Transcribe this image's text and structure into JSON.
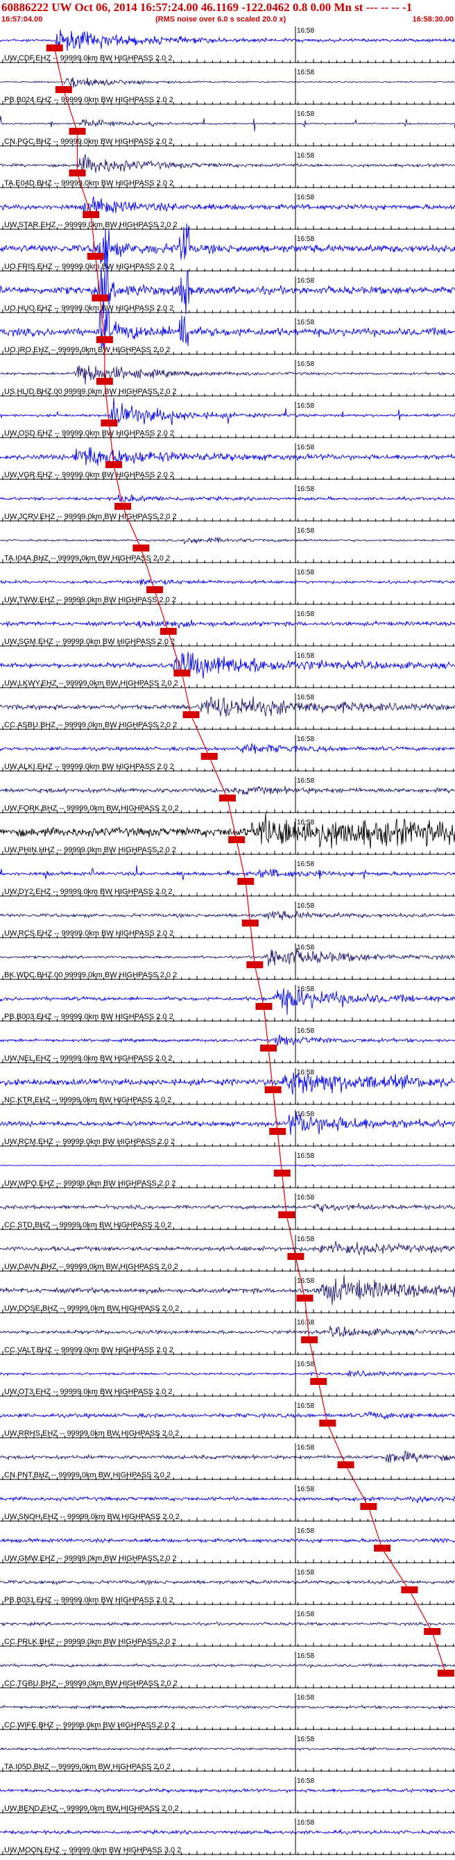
{
  "header": {
    "title": "60886222 UW Oct 06, 2014 16:57:24.00    46.1169 -122.0462  0.8 0.00 Mn st --- -- --  -1",
    "start_time": "16:57:04.00",
    "end_time": "16:58:30.00",
    "rms_note": "(RMS noise over 6.0 s scaled 20.0 x)"
  },
  "minute_marker": "16:58",
  "colors": {
    "blue": "#0000ee",
    "navy": "#1a1a70",
    "black": "#000000",
    "pick": "#d40000",
    "pick_line": "#e00000"
  },
  "traces": [
    {
      "label": "UW.CDF.EHZ -- 99999.0km BW  HIGHPASS  2.0  2",
      "color": "blue",
      "pick": "",
      "onset": 0.12,
      "amp": 0.85,
      "decay": 0.15,
      "noise": 0.12
    },
    {
      "label": "PB.B024.EHZ -- 99999.0km BW  HIGHPASS  2.0  2",
      "color": "navy",
      "pick": "",
      "onset": 0.14,
      "amp": 0.6,
      "decay": 0.1,
      "noise": 0.05
    },
    {
      "label": "CN.PGC.BHZ -- 99999.0km BW  HIGHPASS  2.0  2",
      "color": "navy",
      "pick": "",
      "onset": 0.17,
      "amp": 0.35,
      "decay": 0.1,
      "noise": 0.06,
      "spikes": 9
    },
    {
      "label": "TA.E04D.BHZ -- 99999.0km BW  HIGHPASS  2.0  2",
      "color": "navy",
      "pick": "",
      "onset": 0.17,
      "amp": 0.8,
      "decay": 0.12,
      "noise": 0.12
    },
    {
      "label": "UW.STAR.EHZ -- 99999.0km BW  HIGHPASS  2.0  2",
      "color": "blue",
      "pick": "",
      "onset": 0.18,
      "amp": 0.7,
      "decay": 0.1,
      "noise": 0.2
    },
    {
      "label": "UO.FRIS.EHZ -- 99999.0km BW  HIGHPASS  2.0  2",
      "color": "blue",
      "pick": "",
      "onset": 0.2,
      "amp": 0.5,
      "decay": 0.1,
      "noise": 0.3,
      "bursts": [
        0.23,
        0.405
      ]
    },
    {
      "label": "UO.HUO.EHZ -- 99999.0km BW  HIGHPASS  2.0  2",
      "color": "blue",
      "pick": "",
      "onset": 0.21,
      "amp": 0.5,
      "decay": 0.1,
      "noise": 0.3,
      "bursts": [
        0.23,
        0.405
      ]
    },
    {
      "label": "UO.IRO.EHZ -- 99999.0km BW  HIGHPASS  2.0  2",
      "color": "blue",
      "pick": "",
      "onset": 0.22,
      "amp": 0.6,
      "decay": 0.1,
      "noise": 0.3,
      "bursts": [
        0.23,
        0.405
      ]
    },
    {
      "label": "US.HLID.BHZ.00 99999.0km BW  HIGHPASS  2.0  2",
      "color": "navy",
      "pick": "",
      "onset": 0.16,
      "amp": 1.0,
      "decay": 0.12,
      "noise": 0.1
    },
    {
      "label": "UW.OSD.EHZ -- 99999.0km BW  HIGHPASS  2.0  2",
      "color": "blue",
      "pick": "",
      "onset": 0.24,
      "amp": 1.0,
      "decay": 0.12,
      "noise": 0.1,
      "spikes": 8
    },
    {
      "label": "UW.VGR.EHZ -- 99999.0km BW  HIGHPASS  2.0  2",
      "color": "blue",
      "pick": "",
      "onset": 0.16,
      "amp": 0.9,
      "decay": 0.15,
      "noise": 0.2
    },
    {
      "label": "UW.JCRV.EHZ -- 99999.0km BW  HIGHPASS  2.0  2",
      "color": "blue",
      "pick": "",
      "onset": 0.25,
      "amp": 0.25,
      "decay": 0.1,
      "noise": 0.12
    },
    {
      "label": "TA.I04A.BHZ -- 99999.0km BW  HIGHPASS  2.0  2",
      "color": "navy",
      "pick": "",
      "onset": 0.4,
      "amp": 0.3,
      "decay": 0.1,
      "noise": 0.08
    },
    {
      "label": "UW.TWW.EHZ -- 99999.0km BW  HIGHPASS  2.0  2",
      "color": "blue",
      "pick": "",
      "onset": 0.3,
      "amp": 0.2,
      "decay": 0.1,
      "noise": 0.12
    },
    {
      "label": "UW.SGM.EHZ -- 99999.0km BW  HIGHPASS  2.0  2",
      "color": "blue",
      "pick": "",
      "onset": 0.3,
      "amp": 0.3,
      "decay": 0.1,
      "noise": 0.16
    },
    {
      "label": "UW.LKWY.EHZ -- 99999.0km BW  HIGHPASS  2.0  2",
      "color": "blue",
      "pick": "",
      "onset": 0.38,
      "amp": 1.0,
      "decay": 0.2,
      "noise": 0.2
    },
    {
      "label": "CC.ASBU.BHZ -- 99999.0km BW  HIGHPASS  2.0  2",
      "color": "navy",
      "pick": "",
      "onset": 0.44,
      "amp": 1.0,
      "decay": 0.2,
      "noise": 0.2
    },
    {
      "label": "UW.ALKI.EHZ -- 99999.0km BW  HIGHPASS  2.0  2",
      "color": "blue",
      "pick": "",
      "onset": 0.52,
      "amp": 0.4,
      "decay": 0.1,
      "noise": 0.15
    },
    {
      "label": "UW.FORK.BHZ -- 99999.0km BW  HIGHPASS  2.0  2",
      "color": "navy",
      "pick": "",
      "onset": 0.52,
      "amp": 0.25,
      "decay": 0.1,
      "noise": 0.18
    },
    {
      "label": "UW.PHIN.HHZ -- 99999.0km BW  HIGHPASS  2.0  2",
      "color": "black",
      "pick": "",
      "onset": 0.55,
      "amp": 1.0,
      "decay": 0.9,
      "noise": 0.35
    },
    {
      "label": "UW.DY2.EHZ -- 99999.0km BW  HIGHPASS  2.0  2",
      "color": "blue",
      "pick": "",
      "onset": 0.56,
      "amp": 0.3,
      "decay": 0.1,
      "noise": 0.14,
      "spikes": 10
    },
    {
      "label": "UW.RCS.EHZ -- 99999.0km BW  HIGHPASS  2.0  2",
      "color": "navy",
      "pick": "",
      "onset": 0.58,
      "amp": 0.35,
      "decay": 0.1,
      "noise": 0.14
    },
    {
      "label": "BK.WDC.BHZ.00 99999.0km BW  HIGHPASS  2.0  2",
      "color": "navy",
      "pick": "",
      "onset": 0.58,
      "amp": 0.9,
      "decay": 0.15,
      "noise": 0.1
    },
    {
      "label": "PB.B003.EHZ -- 99999.0km BW  HIGHPASS  2.0  2",
      "color": "blue",
      "pick": "",
      "onset": 0.6,
      "amp": 1.0,
      "decay": 0.15,
      "noise": 0.15
    },
    {
      "label": "UW.NEL.EHZ -- 99999.0km BW  HIGHPASS  2.0  2",
      "color": "blue",
      "pick": "",
      "onset": 0.6,
      "amp": 0.4,
      "decay": 0.1,
      "noise": 0.12
    },
    {
      "label": "NC.KTR.EHZ -- 99999.0km BW  HIGHPASS  2.0  2",
      "color": "blue",
      "pick": "",
      "onset": 0.62,
      "amp": 1.0,
      "decay": 0.2,
      "noise": 0.25
    },
    {
      "label": "UW.RCM.EHZ -- 99999.0km BW  HIGHPASS  2.0  2",
      "color": "blue",
      "pick": "",
      "onset": 0.63,
      "amp": 0.9,
      "decay": 0.15,
      "noise": 0.2
    },
    {
      "label": "UW.WPO.EHZ -- 99999.0km BW  HIGHPASS  2.0  2",
      "color": "blue",
      "pick": "",
      "onset": 0.66,
      "amp": 0.1,
      "decay": 0.1,
      "noise": 0.03
    },
    {
      "label": "CC.STD.BHZ -- 99999.0km BW  HIGHPASS  2.0  2",
      "color": "navy",
      "pick": "",
      "onset": 0.68,
      "amp": 0.3,
      "decay": 0.1,
      "noise": 0.15
    },
    {
      "label": "UW.DAVN.BHZ -- 99999.0km BW  HIGHPASS  2.0  2",
      "color": "navy",
      "pick": "",
      "onset": 0.7,
      "amp": 0.55,
      "decay": 0.15,
      "noise": 0.18
    },
    {
      "label": "UW.DOSE.BHZ -- 99999.0km BW  HIGHPASS  2.0  2",
      "color": "navy",
      "pick": "",
      "onset": 0.7,
      "amp": 1.0,
      "decay": 0.2,
      "noise": 0.2
    },
    {
      "label": "CC.VALT.BHZ -- 99999.0km BW  HIGHPASS  2.0  2",
      "color": "navy",
      "pick": "",
      "onset": 0.72,
      "amp": 0.4,
      "decay": 0.1,
      "noise": 0.15
    },
    {
      "label": "UW.OT3.EHZ -- 99999.0km BW  HIGHPASS  2.0  2",
      "color": "blue",
      "pick": "",
      "onset": 0.76,
      "amp": 0.2,
      "decay": 0.1,
      "noise": 0.1
    },
    {
      "label": "UW.RRHS.EHZ -- 99999.0km BW  HIGHPASS  2.0  2",
      "color": "blue",
      "pick": "",
      "onset": 0.8,
      "amp": 0.2,
      "decay": 0.1,
      "noise": 0.16
    },
    {
      "label": "CN.PNT.BHZ -- 99999.0km BW  HIGHPASS  2.0  2",
      "color": "navy",
      "pick": "",
      "onset": 0.84,
      "amp": 0.5,
      "decay": 0.1,
      "noise": 0.15
    },
    {
      "label": "UW.SNOH.EHZ -- 99999.0km BW  HIGHPASS  2.0  2",
      "color": "blue",
      "pick": "",
      "onset": 0.9,
      "amp": 0.2,
      "decay": 0.1,
      "noise": 0.15
    },
    {
      "label": "UW.GMW.EHZ -- 99999.0km BW  HIGHPASS  2.0  2",
      "color": "blue",
      "pick": "",
      "onset": 0.95,
      "amp": 0.1,
      "decay": 0.1,
      "noise": 0.15
    },
    {
      "label": "PB.B031.EHZ -- 99999.0km BW  HIGHPASS  2.0  2",
      "color": "navy",
      "pick": "",
      "onset": 1.1,
      "amp": 0.0,
      "decay": 0.1,
      "noise": 0.15
    },
    {
      "label": "CC.PRLK.BHZ -- 99999.0km BW  HIGHPASS  2.0  2",
      "color": "navy",
      "pick": "",
      "onset": 1.1,
      "amp": 0.0,
      "decay": 0.1,
      "noise": 0.12
    },
    {
      "label": "CC.TGBU.BHZ -- 99999.0km BW  HIGHPASS  2.0  2",
      "color": "navy",
      "pick": "",
      "onset": 1.1,
      "amp": 0.0,
      "decay": 0.1,
      "noise": 0.12
    },
    {
      "label": "CC.WIFE.BHZ -- 99999.0km BW  HIGHPASS  2.0  2",
      "color": "navy",
      "pick": "",
      "onset": 1.1,
      "amp": 0.0,
      "decay": 0.1,
      "noise": 0.12
    },
    {
      "label": "TA.I05D.BHZ -- 99999.0km BW  HIGHPASS  2.0  2",
      "color": "navy",
      "pick": "",
      "onset": 1.1,
      "amp": 0.0,
      "decay": 0.1,
      "noise": 0.1
    },
    {
      "label": "UW.BEND.EHZ -- 99999.0km BW  HIGHPASS  2.0  2",
      "color": "blue",
      "pick": "",
      "onset": 1.1,
      "amp": 0.0,
      "decay": 0.1,
      "noise": 0.14
    },
    {
      "label": "UW.MOON.EHZ -- 99999.0km BW  HIGHPASS  3.0  2",
      "color": "blue",
      "pick": "",
      "onset": 1.1,
      "amp": 0.0,
      "decay": 0.1,
      "noise": 0.14
    }
  ],
  "picks": [
    0.12,
    0.14,
    0.17,
    0.17,
    0.2,
    0.21,
    0.22,
    0.23,
    0.23,
    0.24,
    0.25,
    0.27,
    0.31,
    0.34,
    0.37,
    0.4,
    0.42,
    0.46,
    0.5,
    0.52,
    0.54,
    0.55,
    0.56,
    0.58,
    0.59,
    0.6,
    0.61,
    0.62,
    0.63,
    0.65,
    0.67,
    0.68,
    0.7,
    0.72,
    0.76,
    0.81,
    0.84,
    0.9,
    0.95,
    0.98
  ]
}
